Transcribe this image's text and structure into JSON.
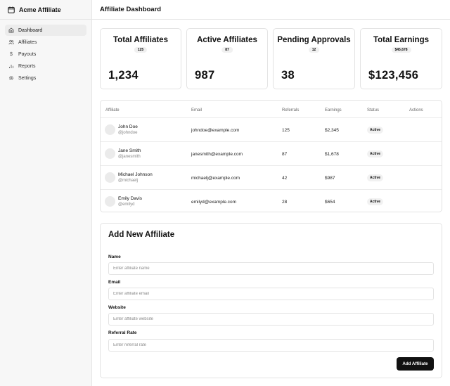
{
  "app": {
    "brand": "Acme Affiliate",
    "page_title": "Affiliate Dashboard"
  },
  "sidebar": {
    "items": [
      {
        "label": "Dashboard",
        "icon": "home-icon",
        "active": true
      },
      {
        "label": "Affiliates",
        "icon": "users-icon",
        "active": false
      },
      {
        "label": "Payouts",
        "icon": "dollar-icon",
        "active": false
      },
      {
        "label": "Reports",
        "icon": "bar-chart-icon",
        "active": false
      },
      {
        "label": "Settings",
        "icon": "gear-icon",
        "active": false
      }
    ]
  },
  "stats": [
    {
      "title": "Total Affiliates",
      "badge": "125",
      "value": "1,234"
    },
    {
      "title": "Active Affiliates",
      "badge": "87",
      "value": "987"
    },
    {
      "title": "Pending Approvals",
      "badge": "12",
      "value": "38"
    },
    {
      "title": "Total Earnings",
      "badge": "$45,678",
      "value": "$123,456"
    }
  ],
  "table": {
    "headers": [
      "Affiliate",
      "Email",
      "Referrals",
      "Earnings",
      "Status",
      "Actions"
    ],
    "rows": [
      {
        "name": "John Doe",
        "handle": "@johndoe",
        "email": "johndoe@example.com",
        "referrals": "125",
        "earnings": "$2,345",
        "status": "Active"
      },
      {
        "name": "Jane Smith",
        "handle": "@janesmith",
        "email": "janesmith@example.com",
        "referrals": "87",
        "earnings": "$1,678",
        "status": "Active"
      },
      {
        "name": "Michael Johnson",
        "handle": "@michaelj",
        "email": "michaelj@example.com",
        "referrals": "42",
        "earnings": "$987",
        "status": "Active"
      },
      {
        "name": "Emily Davis",
        "handle": "@emilyd",
        "email": "emilyd@example.com",
        "referrals": "28",
        "earnings": "$654",
        "status": "Active"
      }
    ]
  },
  "form": {
    "title": "Add New Affiliate",
    "fields": [
      {
        "label": "Name",
        "placeholder": "Enter affiliate name",
        "value": ""
      },
      {
        "label": "Email",
        "placeholder": "Enter affiliate email",
        "value": ""
      },
      {
        "label": "Website",
        "placeholder": "Enter affiliate website",
        "value": ""
      },
      {
        "label": "Referral Rate",
        "placeholder": "Enter referral rate",
        "value": ""
      }
    ],
    "submit_label": "Add Affiliate"
  },
  "colors": {
    "accent": "#111111",
    "sidebar_bg": "#f7f7f7",
    "border": "#e3e3e3",
    "badge_bg": "#f0f0f0"
  }
}
